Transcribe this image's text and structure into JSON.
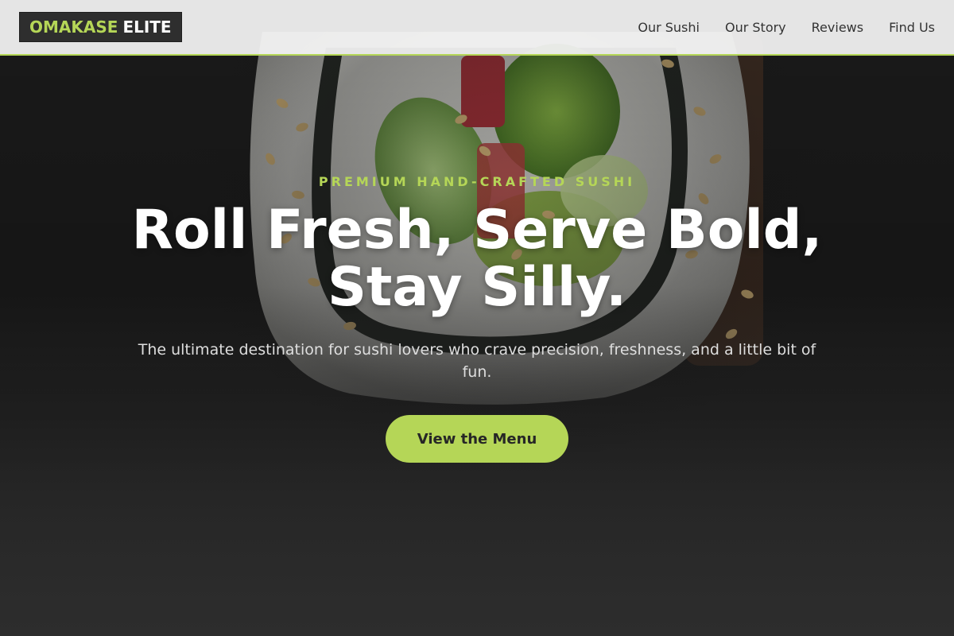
{
  "brand": {
    "logo_primary": "OMAKASE",
    "logo_secondary": "ELITE"
  },
  "nav": {
    "items": [
      {
        "label": "Our Sushi"
      },
      {
        "label": "Our Story"
      },
      {
        "label": "Reviews"
      },
      {
        "label": "Find Us"
      }
    ]
  },
  "hero": {
    "eyebrow": "PREMIUM HAND-CRAFTED SUSHI",
    "headline": "Roll Fresh, Serve Bold, Stay Silly.",
    "subheadline": "The ultimate destination for sushi lovers who crave precision, freshness, and a little bit of fun.",
    "cta_label": "View the Menu",
    "image_subject": "sushi-roll"
  },
  "colors": {
    "accent": "#b5d657",
    "background": "#2a2a2a",
    "header_bg": "#f5f5f5",
    "text_light": "#ffffff",
    "text_dark": "#333333"
  }
}
